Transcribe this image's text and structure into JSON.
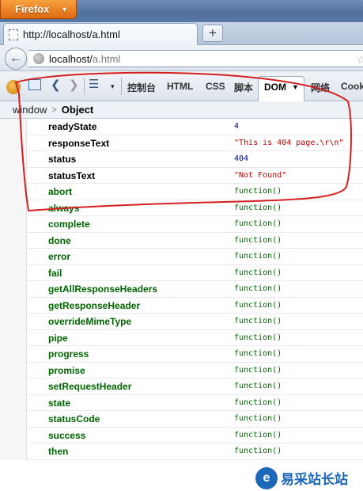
{
  "titlebar": {
    "app_button": "Firefox"
  },
  "tab": {
    "title": "http://localhost/a.html"
  },
  "navbar": {
    "url_host": "localhost/",
    "url_path": "a.html"
  },
  "firebug": {
    "tabs": [
      "控制台",
      "HTML",
      "CSS",
      "脚本",
      "DOM",
      "网络",
      "Cook"
    ],
    "active_tab": "DOM"
  },
  "breadcrumb": {
    "root": "window",
    "separator": ">",
    "current": "Object"
  },
  "dom_rows": [
    {
      "name": "readyState",
      "value": "4",
      "kind": "own",
      "vkind": "num"
    },
    {
      "name": "responseText",
      "value": "\"This is 404 page.\\r\\n\"",
      "kind": "own",
      "vkind": "str"
    },
    {
      "name": "status",
      "value": "404",
      "kind": "own",
      "vkind": "num"
    },
    {
      "name": "statusText",
      "value": "\"Not Found\"",
      "kind": "own",
      "vkind": "str"
    },
    {
      "name": "abort",
      "value": "function()",
      "kind": "fn",
      "vkind": "func"
    },
    {
      "name": "always",
      "value": "function()",
      "kind": "fn",
      "vkind": "func"
    },
    {
      "name": "complete",
      "value": "function()",
      "kind": "fn",
      "vkind": "func"
    },
    {
      "name": "done",
      "value": "function()",
      "kind": "fn",
      "vkind": "func"
    },
    {
      "name": "error",
      "value": "function()",
      "kind": "fn",
      "vkind": "func"
    },
    {
      "name": "fail",
      "value": "function()",
      "kind": "fn",
      "vkind": "func"
    },
    {
      "name": "getAllResponseHeaders",
      "value": "function()",
      "kind": "fn",
      "vkind": "func"
    },
    {
      "name": "getResponseHeader",
      "value": "function()",
      "kind": "fn",
      "vkind": "func"
    },
    {
      "name": "overrideMimeType",
      "value": "function()",
      "kind": "fn",
      "vkind": "func"
    },
    {
      "name": "pipe",
      "value": "function()",
      "kind": "fn",
      "vkind": "func"
    },
    {
      "name": "progress",
      "value": "function()",
      "kind": "fn",
      "vkind": "func"
    },
    {
      "name": "promise",
      "value": "function()",
      "kind": "fn",
      "vkind": "func"
    },
    {
      "name": "setRequestHeader",
      "value": "function()",
      "kind": "fn",
      "vkind": "func"
    },
    {
      "name": "state",
      "value": "function()",
      "kind": "fn",
      "vkind": "func"
    },
    {
      "name": "statusCode",
      "value": "function()",
      "kind": "fn",
      "vkind": "func"
    },
    {
      "name": "success",
      "value": "function()",
      "kind": "fn",
      "vkind": "func"
    },
    {
      "name": "then",
      "value": "function()",
      "kind": "fn",
      "vkind": "func"
    }
  ],
  "watermark": {
    "logo": "e",
    "text": "易采站长站"
  },
  "colors": {
    "property_fn": "#006400",
    "value_string": "#c00000",
    "value_number": "#000080",
    "annotation": "#d42020"
  }
}
